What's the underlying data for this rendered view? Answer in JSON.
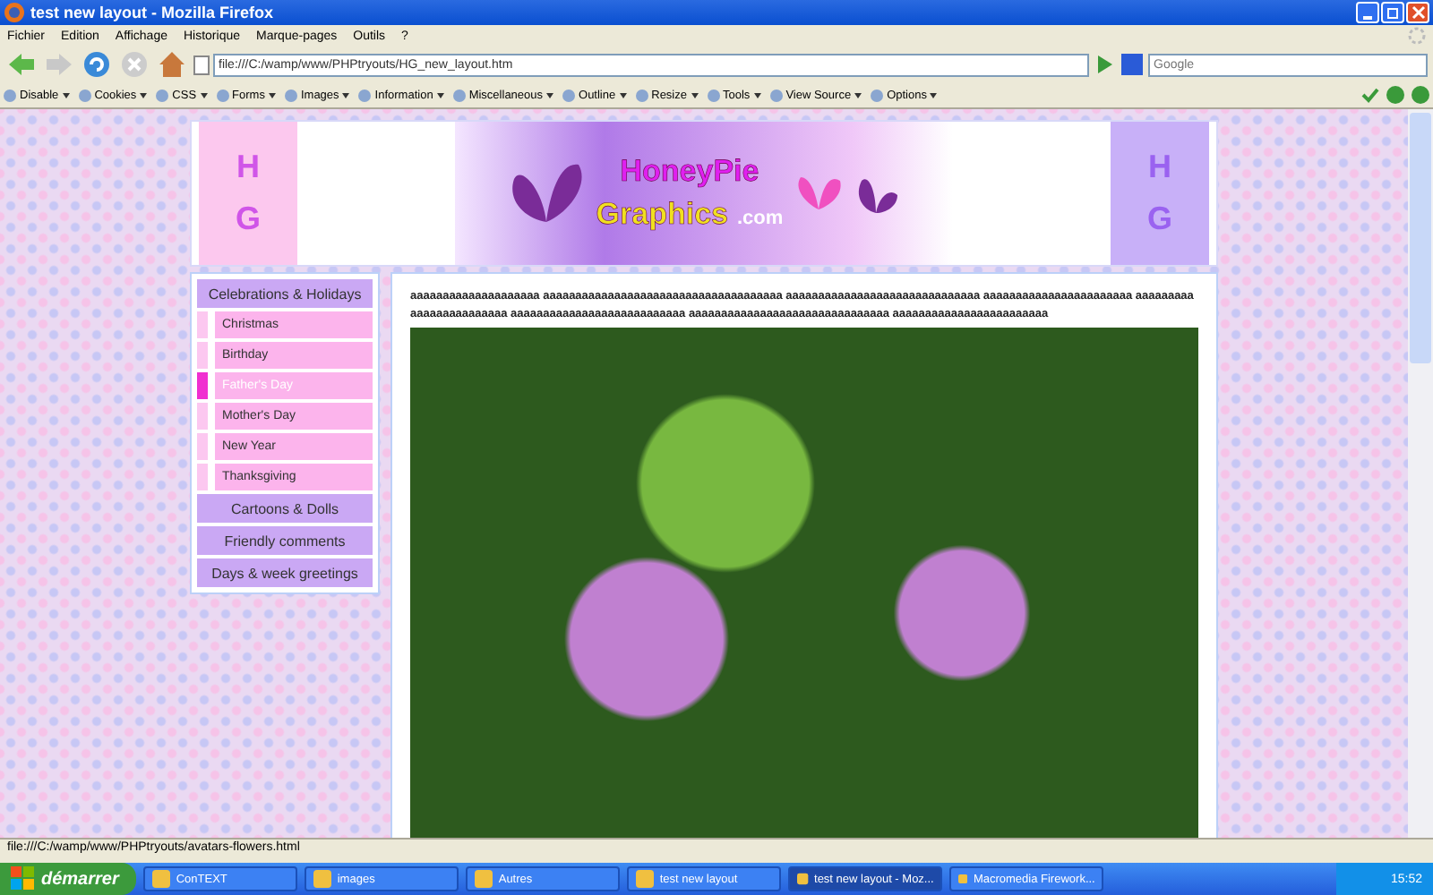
{
  "window": {
    "title": "test new layout - Mozilla Firefox"
  },
  "menu_bar": [
    "Fichier",
    "Edition",
    "Affichage",
    "Historique",
    "Marque-pages",
    "Outils",
    "?"
  ],
  "address_bar": {
    "value": "file:///C:/wamp/www/PHPtryouts/HG_new_layout.htm"
  },
  "search_field": {
    "placeholder": "Google"
  },
  "dev_toolbar": [
    "Disable",
    "Cookies",
    "CSS",
    "Forms",
    "Images",
    "Information",
    "Miscellaneous",
    "Outline",
    "Resize",
    "Tools",
    "View Source",
    "Options"
  ],
  "banner": {
    "side_tiles": [
      {
        "letters": [
          "H",
          "G"
        ]
      },
      {
        "letters": [
          "H",
          "G"
        ]
      }
    ],
    "logo_lines": [
      "HoneyPie",
      "Graphics"
    ],
    "logo_suffix": ".com"
  },
  "sidebar": {
    "items": [
      {
        "label": "Celebrations & Holidays",
        "children": [
          {
            "label": "Christmas",
            "selected": false
          },
          {
            "label": "Birthday",
            "selected": false
          },
          {
            "label": "Father's Day",
            "selected": true
          },
          {
            "label": "Mother's Day",
            "selected": false
          },
          {
            "label": "New Year",
            "selected": false
          },
          {
            "label": "Thanksgiving",
            "selected": false
          }
        ]
      },
      {
        "label": "Cartoons & Dolls"
      },
      {
        "label": "Friendly comments"
      },
      {
        "label": "Days & week greetings"
      }
    ]
  },
  "content": {
    "paragraph": "aaaaaaaaaaaaaaaaaaaa aaaaaaaaaaaaaaaaaaaaaaaaaaaaaaaaaaaaa aaaaaaaaaaaaaaaaaaaaaaaaaaaaaa aaaaaaaaaaaaaaaaaaaaaaa aaaaaaaaaaaaaaaaaaaaaaaa aaaaaaaaaaaaaaaaaaaaaaaaaaa aaaaaaaaaaaaaaaaaaaaaaaaaaaaaaa aaaaaaaaaaaaaaaaaaaaaaaa"
  },
  "status_bar": "file:///C:/wamp/www/PHPtryouts/avatars-flowers.html",
  "taskbar": {
    "start": "démarrer",
    "tasks": [
      {
        "label": "ConTEXT",
        "selected": false
      },
      {
        "label": "images",
        "selected": false
      },
      {
        "label": "Autres",
        "selected": false
      },
      {
        "label": "test new layout",
        "selected": false
      },
      {
        "label": "test new layout - Moz...",
        "selected": true
      },
      {
        "label": "Macromedia Firework...",
        "selected": false
      }
    ],
    "clock": "15:52"
  }
}
